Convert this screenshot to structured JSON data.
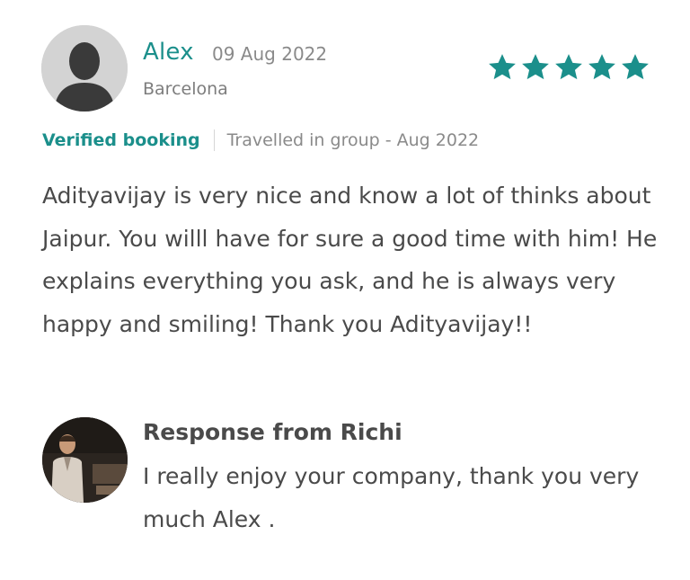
{
  "review": {
    "author": {
      "name": "Alex",
      "date": "09 Aug 2022",
      "location": "Barcelona",
      "avatar_icon": "user-silhouette-icon"
    },
    "rating": {
      "stars": 5,
      "max": 5,
      "color": "#1b8f8b",
      "icon": "star-icon"
    },
    "badge": "Verified booking",
    "trip_info": "Travelled in group - Aug 2022",
    "text": "Adityavijay is very nice and know a lot of thinks about Jaipur. You willl have for sure a good time with him! He explains everything you ask, and he is always very happy and smiling! Thank you Adityavijay!!"
  },
  "response": {
    "title": "Response from Richi",
    "text": "I really enjoy your company, thank you very much Alex .",
    "avatar_icon": "host-photo-avatar"
  },
  "colors": {
    "accent": "#1b8f8b",
    "text": "#4a4a4a",
    "muted": "#8a8a8a"
  }
}
